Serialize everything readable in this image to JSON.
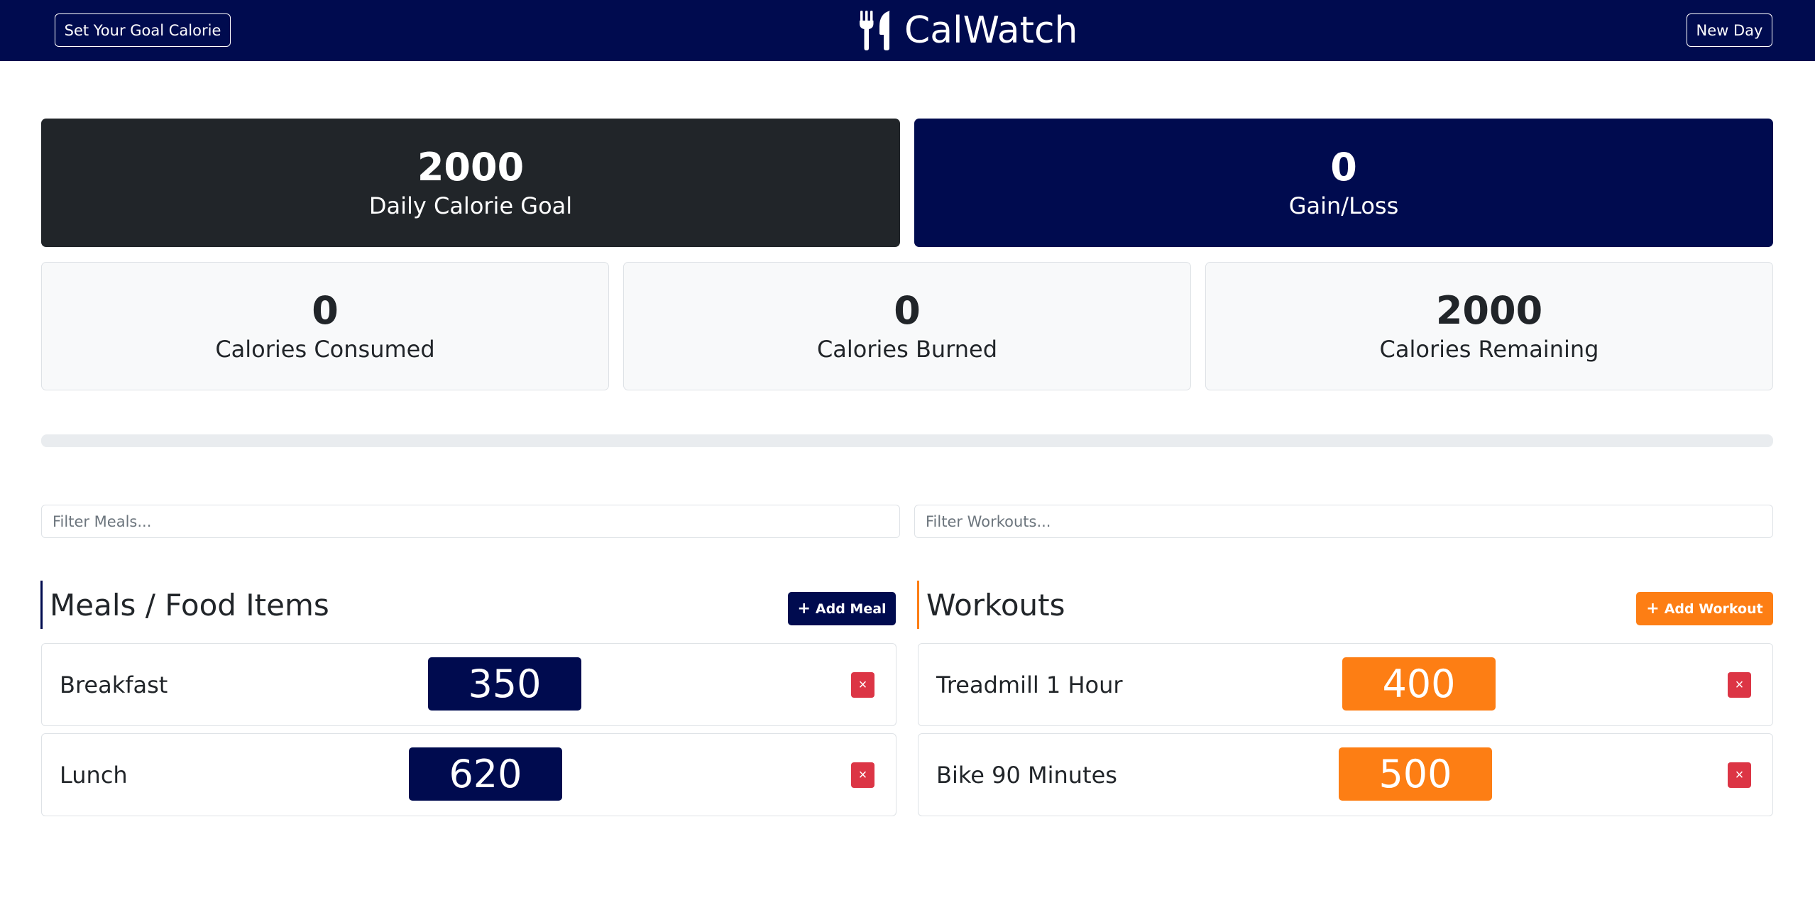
{
  "navbar": {
    "goal_button": "Set Your Goal Calorie",
    "brand": "CalWatch",
    "brand_icon": "utensils-icon",
    "new_day_button": "New Day",
    "background": "#000b4f"
  },
  "stats": {
    "goal": {
      "value": "2000",
      "label": "Daily Calorie Goal"
    },
    "gain_loss": {
      "value": "0",
      "label": "Gain/Loss"
    },
    "consumed": {
      "value": "0",
      "label": "Calories Consumed"
    },
    "burned": {
      "value": "0",
      "label": "Calories Burned"
    },
    "remaining": {
      "value": "2000",
      "label": "Calories Remaining"
    }
  },
  "progress": {
    "percent": 0
  },
  "filters": {
    "meals_placeholder": "Filter Meals...",
    "workouts_placeholder": "Filter Workouts..."
  },
  "meals": {
    "title": "Meals / Food Items",
    "add_button": "Add Meal",
    "items": [
      {
        "name": "Breakfast",
        "calories": "350"
      },
      {
        "name": "Lunch",
        "calories": "620"
      }
    ]
  },
  "workouts": {
    "title": "Workouts",
    "add_button": "Add Workout",
    "items": [
      {
        "name": "Treadmill 1 Hour",
        "calories": "400"
      },
      {
        "name": "Bike 90 Minutes",
        "calories": "500"
      }
    ]
  },
  "delete_symbol": "×",
  "add_symbol": "+",
  "colors": {
    "navy": "#000b4f",
    "dark": "#212529",
    "orange": "#fd7e14",
    "danger": "#dc3545"
  }
}
